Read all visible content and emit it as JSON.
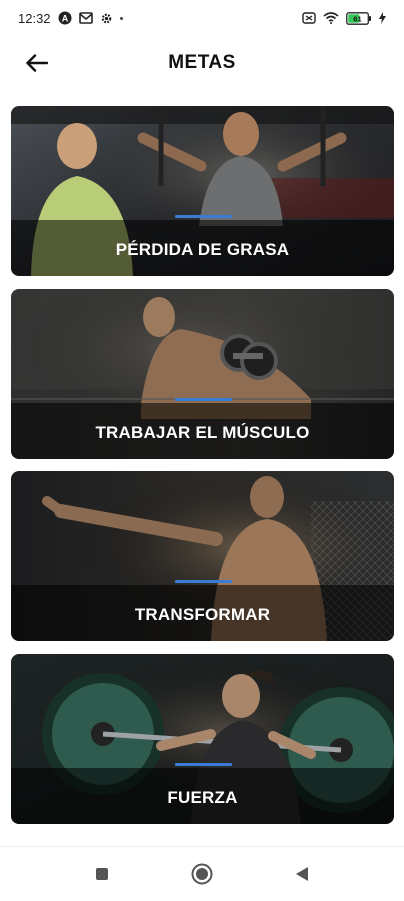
{
  "status_bar": {
    "time": "12:32",
    "left_icons": [
      "a-circle-icon",
      "mail-icon",
      "settings-gear-icon",
      "dot-icon"
    ],
    "right_icons": [
      "sim-icon",
      "wifi-icon",
      "battery-icon",
      "charging-bolt-icon"
    ],
    "battery_text": "61"
  },
  "header": {
    "title": "METAS",
    "back_icon": "arrow-left-icon"
  },
  "goals": [
    {
      "label": "PÉRDIDA DE GRASA"
    },
    {
      "label": "TRABAJAR EL MÚSCULO"
    },
    {
      "label": "TRANSFORMAR"
    },
    {
      "label": "FUERZA"
    }
  ],
  "colors": {
    "accent": "#3a7bd5",
    "card_overlay": "#000000",
    "background": "#ffffff"
  },
  "nav_bar": {
    "buttons": [
      "square-icon",
      "circle-home-icon",
      "triangle-back-icon"
    ]
  }
}
